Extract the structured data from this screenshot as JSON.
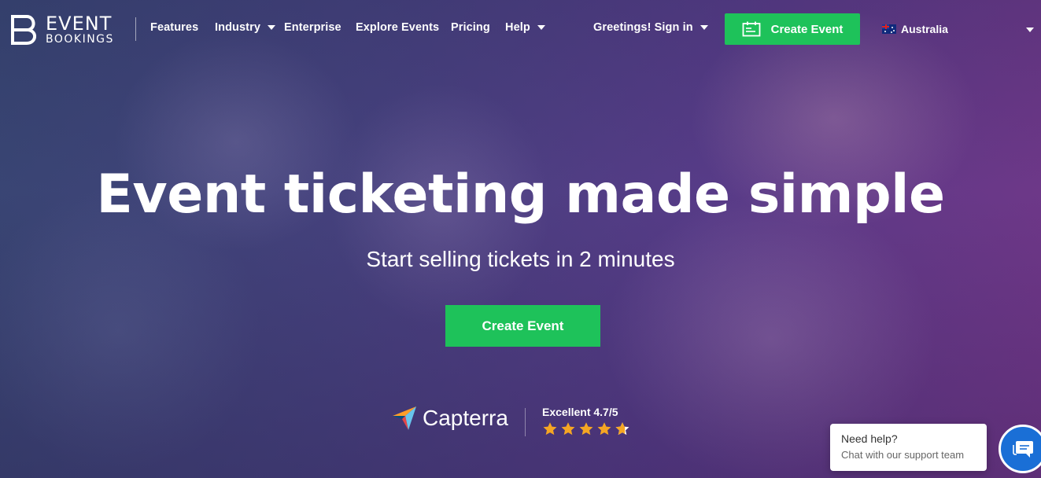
{
  "brand": {
    "line1": "EVENT",
    "line2": "BOOKINGS"
  },
  "nav": {
    "items": [
      {
        "label": "Features",
        "dropdown": false
      },
      {
        "label": "Industry",
        "dropdown": true
      },
      {
        "label": "Enterprise",
        "dropdown": false
      },
      {
        "label": "Explore Events",
        "dropdown": false
      },
      {
        "label": "Pricing",
        "dropdown": false
      },
      {
        "label": "Help",
        "dropdown": true
      }
    ],
    "signin_label": "Greetings! Sign in",
    "create_event_label": "Create Event",
    "country_label": "Australia"
  },
  "hero": {
    "headline": "Event ticketing made simple",
    "subline": "Start selling tickets in 2 minutes",
    "cta_label": "Create Event"
  },
  "review": {
    "provider": "Capterra",
    "rating_text": "Excellent 4.7/5",
    "rating_value": 4.7,
    "rating_max": 5
  },
  "chat": {
    "title": "Need help?",
    "subtitle": "Chat with our support team"
  },
  "colors": {
    "accent_green": "#1ec25a",
    "chat_blue": "#1a6fd6",
    "star_orange": "#f5a623"
  }
}
